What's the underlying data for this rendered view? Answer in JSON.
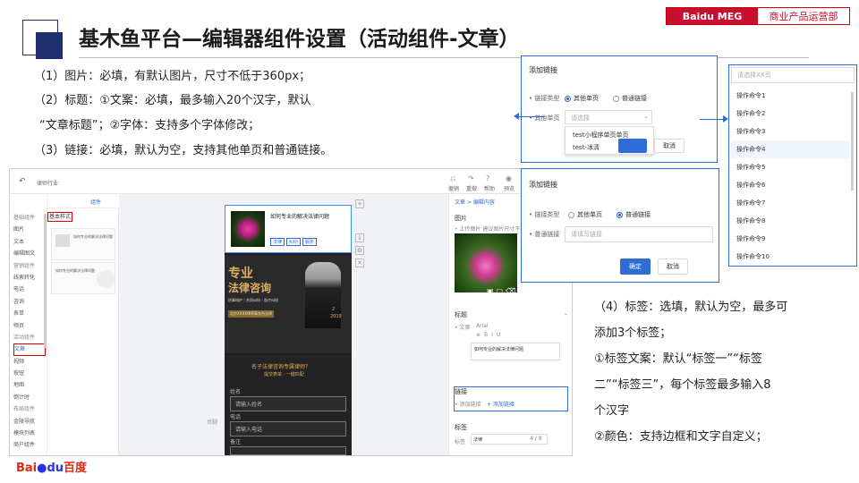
{
  "header": {
    "title": "基木鱼平台—编辑器组件设置（活动组件-文章）",
    "brand_tag": "Baidu MEG",
    "dept_tag": "商业产品运营部"
  },
  "rules": [
    "（1）图片：必填，有默认图片，尺寸不低于360px；",
    "（2）标题：①文案：必填，最多输入20个汉字，默认",
    "“文章标题”；②字体：支持多个字体修改；",
    "（3）链接：必填，默认为空，支持其他单页和普通链接。"
  ],
  "tag_rules": [
    "（4）标签：选填，默认为空，最多可",
    "添加3个标签；",
    "①标签文案：默认“标签一”“标签",
    "二”“标签三”，每个标签最多输入8",
    "个汉字",
    "②颜色：支持边框和文字自定义；"
  ],
  "editor": {
    "industry": "律师行业",
    "toolbar": [
      "撤销",
      "重做",
      "帮助",
      "预览"
    ],
    "tabs": [
      "模板",
      "组件"
    ],
    "categories": [
      {
        "label": "基础组件",
        "h": true
      },
      {
        "label": "图片"
      },
      {
        "label": "文本"
      },
      {
        "label": "编辑图文"
      },
      {
        "label": "营销组件",
        "h": true
      },
      {
        "label": "线索转化"
      },
      {
        "label": "电话"
      },
      {
        "label": "咨询"
      },
      {
        "label": "表单"
      },
      {
        "label": "频页"
      },
      {
        "label": "活动组件",
        "h": true
      },
      {
        "label": "文章",
        "sel": true
      },
      {
        "label": "视频"
      },
      {
        "label": "按钮"
      },
      {
        "label": "地图"
      },
      {
        "label": "倒计时"
      },
      {
        "label": "布局组件",
        "h": true
      },
      {
        "label": "金陵导航"
      },
      {
        "label": "模块列表"
      },
      {
        "label": "商户组件"
      }
    ],
    "style_label": "基本样式",
    "style_caption_1": "如何专业的解决法律问题",
    "style_caption_2": "如何专业的解决法律问题",
    "article_title": "如何专业的解决法律问题",
    "article_tags": [
      "法律",
      "纠纷",
      "服务"
    ],
    "banner_line1": "专业",
    "banner_line2": "法律咨询",
    "banner_sub": "刑事辩护｜合同纠纷｜医疗纠纷",
    "banner_year_top": "2",
    "banner_year": "2019",
    "banner_firm": "北京XXXX律师事务所法律",
    "form_title": "名子法律咨询专属律师？",
    "form_sub": "提交表单 · 一键匹配",
    "form_name_label": "姓名",
    "form_name": "请输入姓名",
    "form_phone_label": "电话",
    "form_phone": "请输入电话",
    "form_extra_label": "备注",
    "canvas_footer": "页脚",
    "breadcrumb": "文章 > 编辑内容",
    "r_image": "图片",
    "r_image_hint": "• 上传图片 建议图片尺寸不小于",
    "r_title": "标题",
    "r_text_label": "• 文案",
    "r_font": "Arial",
    "r_title_text": "如何专业的解决法律问题",
    "r_link": "链接",
    "r_link_label": "• 添加链接",
    "r_link_add": "+ 添加链接",
    "r_tag": "标签",
    "r_tag_label": "标签",
    "r_tag_value": "法律",
    "r_tag_count": "4 / 8"
  },
  "dialog1": {
    "title": "添加链接",
    "type_label": "• 链接类型",
    "opt1": "其他单页",
    "opt2": "普通链接",
    "page_label": "• 其他单页",
    "placeholder": "请选择",
    "options": [
      "test小程序单页单页",
      "test-冰清"
    ],
    "cancel": "取消"
  },
  "dialog2": {
    "title": "添加链接",
    "type_label": "• 链接类型",
    "opt1": "其他单页",
    "opt2": "普通链接",
    "link_label": "• 普通链接",
    "placeholder": "请填写链接",
    "ok": "确定",
    "cancel": "取消"
  },
  "dropdown": {
    "placeholder": "请选择XX页",
    "items": [
      "操作命令1",
      "操作命令2",
      "操作命令3",
      "操作命令4",
      "操作命令5",
      "操作命令6",
      "操作命令7",
      "操作命令8",
      "操作命令9",
      "操作命令10"
    ]
  },
  "footer": {
    "logo_bai": "Bai",
    "logo_du": "du",
    "logo_cn": "百度"
  }
}
